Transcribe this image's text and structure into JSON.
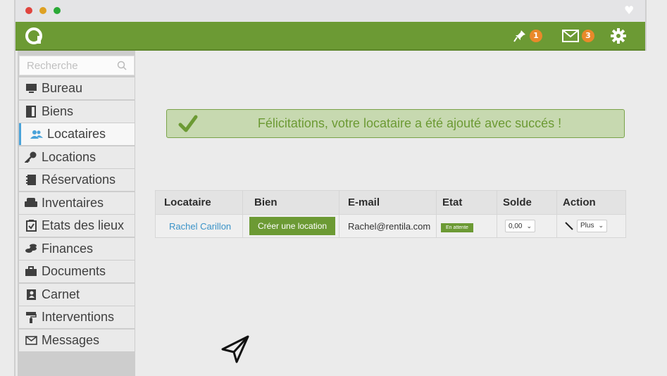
{
  "colors": {
    "brand_green": "#6c9a34",
    "badge_orange": "#e9892a",
    "link_blue": "#3b93c8",
    "active_indicator": "#4aa3d9"
  },
  "topbar": {
    "pin_count": "1",
    "messages_count": "3",
    "icons": [
      "logo-icon",
      "pin-icon",
      "envelope-icon",
      "gear-icon"
    ]
  },
  "sidebar": {
    "search_placeholder": "Recherche",
    "items": [
      {
        "label": "Bureau",
        "icon": "monitor-icon"
      },
      {
        "label": "Biens",
        "icon": "door-icon"
      },
      {
        "label": "Locataires",
        "icon": "users-icon",
        "active": true
      },
      {
        "label": "Locations",
        "icon": "key-icon"
      },
      {
        "label": "Réservations",
        "icon": "notebook-icon"
      },
      {
        "label": "Inventaires",
        "icon": "armchair-icon"
      },
      {
        "label": "Etats des lieux",
        "icon": "clipboard-check-icon"
      },
      {
        "label": "Finances",
        "icon": "coins-icon"
      },
      {
        "label": "Documents",
        "icon": "briefcase-icon"
      },
      {
        "label": "Carnet",
        "icon": "contact-book-icon"
      },
      {
        "label": "Interventions",
        "icon": "paint-roller-icon"
      },
      {
        "label": "Messages",
        "icon": "envelope-icon"
      }
    ]
  },
  "alert": {
    "message": "Félicitations, votre locataire a été ajouté avec succés !"
  },
  "table": {
    "headers": [
      "Locataire",
      "Bien",
      "E-mail",
      "Etat",
      "Solde",
      "Action"
    ],
    "row": {
      "locataire": "Rachel Carillon",
      "bien_button": "Créer une location",
      "email": "Rachel@rentila.com",
      "etat": "En attente",
      "solde": "0,00",
      "action_select": "Plus"
    }
  }
}
